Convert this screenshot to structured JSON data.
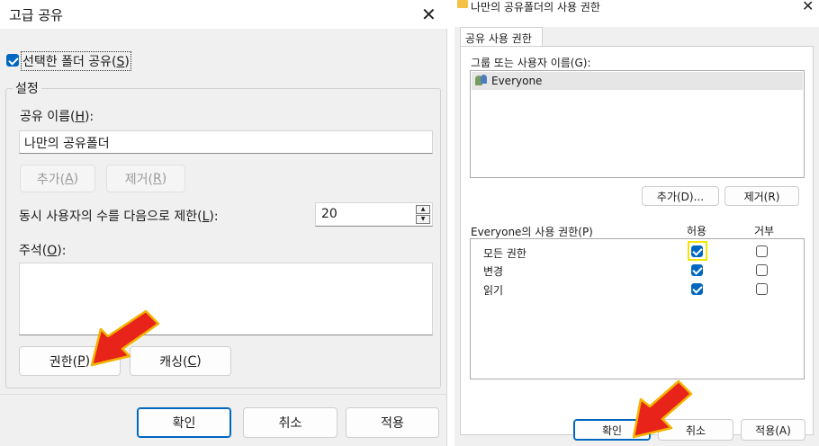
{
  "left_dialog": {
    "title": "고급 공유",
    "share_checkbox": {
      "label_pre": "선택한 폴더 공유(",
      "label_key": "S",
      "label_post": ")",
      "checked": true
    },
    "settings_group": "설정",
    "share_name_label": {
      "pre": "공유 이름(",
      "key": "H",
      "post": "):"
    },
    "share_name_value": "나만의 공유폴더",
    "add_button": {
      "pre": "추가(",
      "key": "A",
      "post": ")"
    },
    "remove_button": {
      "pre": "제거(",
      "key": "R",
      "post": ")"
    },
    "limit_label": {
      "pre": "동시 사용자의 수를 다음으로 제한(",
      "key": "L",
      "post": "):"
    },
    "limit_value": "20",
    "comment_label": {
      "pre": "주석(",
      "key": "O",
      "post": "):"
    },
    "comment_value": "",
    "permissions_button": {
      "pre": "권한(",
      "key": "P",
      "post": ")"
    },
    "caching_button": {
      "pre": "캐싱(",
      "key": "C",
      "post": ")"
    },
    "ok_button": "확인",
    "cancel_button": "취소",
    "apply_button": "적용"
  },
  "right_dialog": {
    "title": "나만의 공유폴더의 사용 권한",
    "tab": "공유 사용 권한",
    "group_label": "그룹 또는 사용자 이름(G):",
    "users": [
      "Everyone"
    ],
    "add_button": "추가(D)...",
    "remove_button": "제거(R)",
    "permissions_for": "Everyone의 사용 권한(P)",
    "allow_header": "허용",
    "deny_header": "거부",
    "permissions": [
      {
        "name": "모든 권한",
        "allow": true,
        "deny": false
      },
      {
        "name": "변경",
        "allow": true,
        "deny": false
      },
      {
        "name": "읽기",
        "allow": true,
        "deny": false
      }
    ],
    "ok_button": "확인",
    "cancel_button": "취소",
    "apply_button": "적용(A)"
  },
  "colors": {
    "accent": "#0067c0",
    "arrow": "#e8231a",
    "highlight": "#f2e600"
  }
}
